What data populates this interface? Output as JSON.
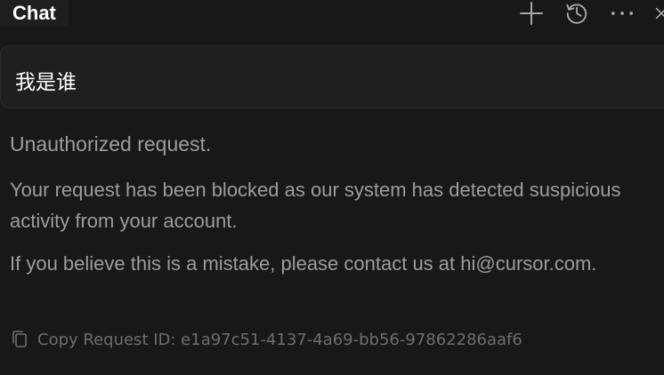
{
  "header": {
    "title": "Chat",
    "icons": [
      "plus-icon",
      "history-icon",
      "more-icon",
      "close-icon"
    ]
  },
  "user_message": {
    "text": "我是谁"
  },
  "response": {
    "title": "Unauthorized request.",
    "paragraph_1": "Your request has been blocked as our system has detected suspicious activity from your account.",
    "paragraph_2": "If you believe this is a mistake, please contact us at hi@cursor.com."
  },
  "footer": {
    "copy_label": "Copy Request ID: e1a97c51-4137-4a69-bb56-97862286aaf6",
    "icon": "copy-icon"
  },
  "colors": {
    "background": "#181818",
    "panel": "#1f1f1f",
    "text_primary": "#ffffff",
    "text_muted": "#9c9c9c",
    "text_dim": "#6e6e6e"
  }
}
